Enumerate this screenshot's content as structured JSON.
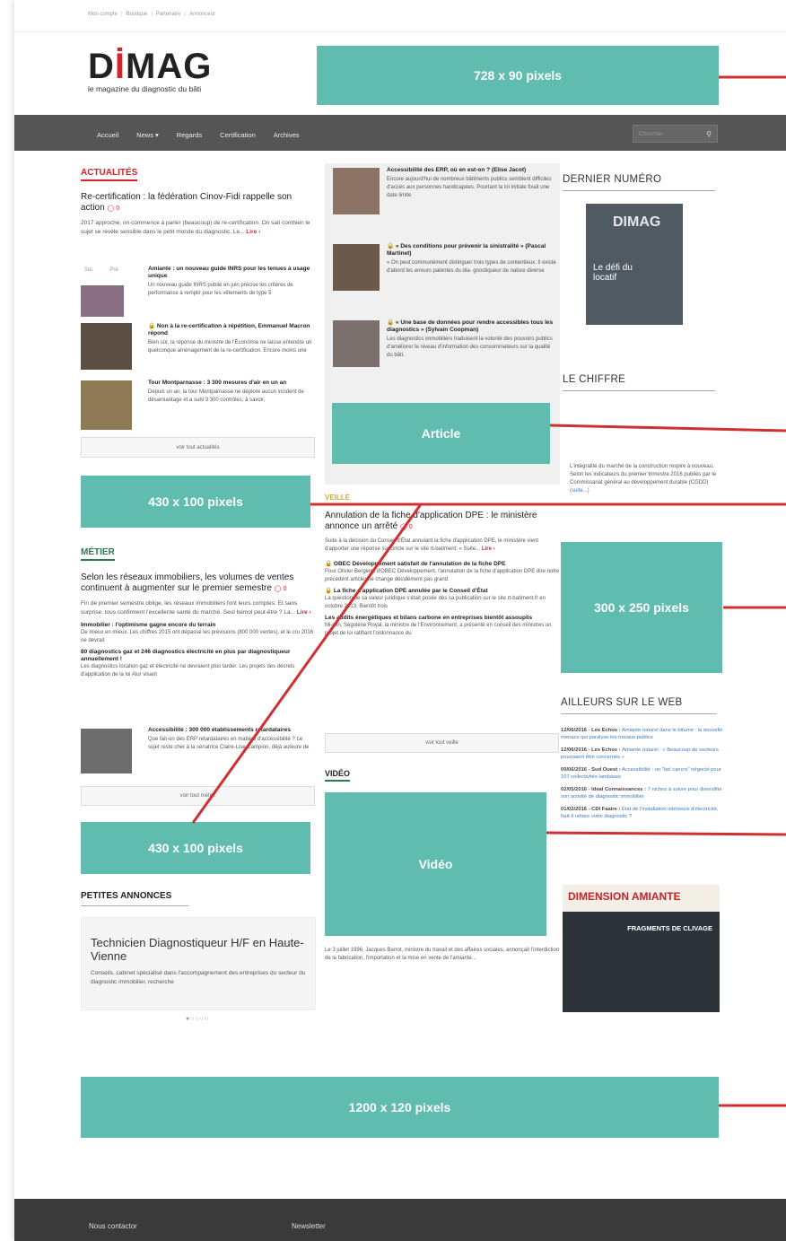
{
  "topbar": {
    "links": [
      "Mon compte",
      "Boutique",
      "Partenaire",
      "Annonceur"
    ]
  },
  "logo": {
    "main_a": "D",
    "main_i": "İ",
    "main_b": "MAG",
    "tagline": "le magazine du diagnostic du bâti"
  },
  "ads": {
    "leaderboard": "728 x 90 pixels",
    "article": "Article",
    "left1": "430 x 100 pixels",
    "mid_rect": "300 x 250 pixels",
    "left2": "430 x 100 pixels",
    "video": "Vidéo",
    "bottom": "1200 x 120 pixels"
  },
  "nav": {
    "items": [
      "Accueil",
      "News ▾",
      "Regards",
      "Certification",
      "Archives"
    ],
    "search_placeholder": "Chercher"
  },
  "actualites": {
    "title": "ACTUALITÉS",
    "lead_title": "Re-certification : la fédération Cinov-Fidi rappelle son action",
    "lead_count": "0",
    "lead_text": "2017 approche, on commence à parler (beaucoup) de re-certification. On sait combien le sujet se révèle sensible dans le petit monde du diagnostic. Le...",
    "lead_more": "Lire ›",
    "prevnext": [
      "Sui.",
      "Pré."
    ],
    "items": [
      {
        "title": "Amiante : un nouveau guide INRS pour les tenues à usage unique",
        "count": "0",
        "text": "Un nouveau guide INRS publié en juin précise les critères de performance à remplir pour les vêtements de type 5"
      },
      {
        "title": "Non à la re-certification à répétition, Emmanuel Macron répond",
        "count": "0",
        "text": "Bien sûr, la réponse du ministre de l'Économie ne laisse entendre un quelconque aménagement de la re-certification. Encore moins une"
      },
      {
        "title": "Tour Montparnasse : 3 300 mesures d'air en un an",
        "count": "0",
        "text": "Depuis un an, la tour Montparnasse ne déplore aucun incident de désamiantage et a subi 3 300 contrôles, à savoir,"
      }
    ],
    "all_button": "voir tout actualités"
  },
  "featured": {
    "items": [
      {
        "title": "Accessibilité des ERP, où en est-on ? (Elise Jacot)",
        "count": "0",
        "text": "Encore aujourd'hui de nombreux bâtiments publics semblent difficiles d'accès aux personnes handicapées. Pourtant la loi initiale fixait une date limite"
      },
      {
        "title": "« Des conditions pour prévenir la sinistralité » (Pascal Martinet)",
        "count": "0",
        "text": "« On peut communément distinguer trois types de contentieux. Il existe d'abord les erreurs patentes du dia- gnostiqueur de nature diverse"
      },
      {
        "title": "« Une base de données pour rendre accessibles tous les diagnostics » (Sylvain Coopman)",
        "count": "0",
        "text": "Les diagnostics immobiliers traduisent la volonté des pouvoirs publics d'améliorer le niveau d'information des consommateurs sur la qualité du bâti."
      }
    ]
  },
  "veille": {
    "title": "VEILLE",
    "lead_title": "Annulation de la fiche d'application DPE : le ministère annonce un arrêté",
    "lead_count": "0",
    "lead_text": "Suite à la décision du Conseil d'État annulant la fiche d'application DPE, le ministère vient d'apporter une réponse succincte sur le site rt-batiment. « Suite...",
    "lead_more": "Lire ›",
    "items": [
      {
        "title": "OBEC Développement satisfait de l'annulation de la fiche DPE",
        "count": "0",
        "text": "Pour Olivier Bergeret d'OBEC Développement, l'annulation de la fiche d'application DPE dire notre précédent article) ne change décidément pas grand"
      },
      {
        "title": "La fiche d'application DPE annulée par le Conseil d'État",
        "count": "0",
        "text": "La question de sa valeur juridique s'était posée dès sa publication sur le site rt-batiment.fr en octobre 2013. Bientôt trois"
      },
      {
        "title": "Les audits énergétiques et bilans carbone en entreprises bientôt assouplis",
        "count": "0",
        "text": "Mi-juin, Ségolène Royal, la ministre de l'Environnement, a présenté en conseil des ministres un projet de loi ratifiant l'ordonnance du"
      }
    ],
    "all_button": "voir tout veille"
  },
  "video": {
    "title": "VIDÉO",
    "caption": "Le 3 juillet 1996, Jacques Barrot, ministre du travail et des affaires sociales, annonçait l'interdiction de la fabrication, l'importation et la mise en vente de l'amiante..."
  },
  "metier": {
    "title": "MÉTIER",
    "lead_title": "Selon les réseaux immobiliers, les volumes de ventes continuent à augmenter sur le premier semestre",
    "lead_count": "0",
    "lead_text": "Fin de premier semestre oblige, les réseaux immobiliers font leurs comptes. Et sans surprise, tous confirment l'excellente santé du marché. Seul bémol peut-être ? La...",
    "lead_more": "Lire ›",
    "items": [
      {
        "title": "Immobilier : l'optimisme gagne encore du terrain",
        "count": "0",
        "text": "De mieux en mieux. Les chiffres 2015 ont dépassé les prévisions (800 000 ventes), et le cru 2016 ne devrait"
      },
      {
        "title": "80 diagnostics gaz et 246 diagnostics électricité en plus par diagnostiqueur annuellement !",
        "count": "0",
        "text": "Les diagnostics location gaz et électricité ne devraient plus tarder. Les projets des décrets d'application de la loi Alur visant"
      },
      {
        "title": "Accessibilité : 300 000 établissements retardataires",
        "count": "0",
        "text": "Que fait-on des ERP retardataires en matière d'accessibilité ? Le sujet reste cher à la sénatrice Claire-Lise Campion, déjà auteure de"
      }
    ],
    "all_button": "voir tout métier"
  },
  "annonces": {
    "title": "PETITES ANNONCES",
    "job_title": "Technicien Diagnostiqueur H/F en Haute-Vienne",
    "job_text": "Conseils, cabinet spécialisé dans l'accompagnement des entreprises du secteur du diagnostic immobilier, recherche"
  },
  "sidebar": {
    "dernier_title": "DERNIER NUMÉRO",
    "cover_brand": "DIMAG",
    "cover_headline": "Le défi du locatif",
    "chiffre_title": "LE CHIFFRE",
    "chiffre_text": "L'intégralité du marché de la construction respire à nouveau. Selon les indicateurs du premier trimestre 2016 publiés par le Commissariat général au développement durable (CGDD)",
    "chiffre_more": "(suite...)",
    "web_title": "AILLEURS SUR LE WEB",
    "web": [
      {
        "date": "12/06/2016 - Les Echos :",
        "link": "Amiante naturel dans le bitume : la nouvelle menace qui paralyse les travaux publics"
      },
      {
        "date": "12/06/2016 - Les Echos :",
        "link": "Amiante naturel : « Beaucoup de secteurs pourraient être concernés »"
      },
      {
        "date": "09/06/2016 - Sud Ouest :",
        "link": "Accessibilité : un \"bel cancre\" négocié pour 107 collectivités landaises"
      },
      {
        "date": "02/05/2016 - Ideal Connaissances :",
        "link": "7 niches à suivre pour diversifier son activité de diagnostic immobilier"
      },
      {
        "date": "01/02/2016 - CDI Faaire :",
        "link": "État de l'installation intérieure d'électricité, faut-il refaire votre diagnostic ?"
      }
    ],
    "magazine_brand": "DIMENSION AMIANTE",
    "magazine_headline": "FRAGMENTS DE CLIVAGE"
  },
  "footer": {
    "contact": "Nous contactor",
    "newsletter": "Newsletter"
  },
  "colors": {
    "accent": "#5fbcae",
    "brand_red": "#d5232a",
    "nav_bg": "#555555",
    "annotation_line": "#cf3133"
  }
}
